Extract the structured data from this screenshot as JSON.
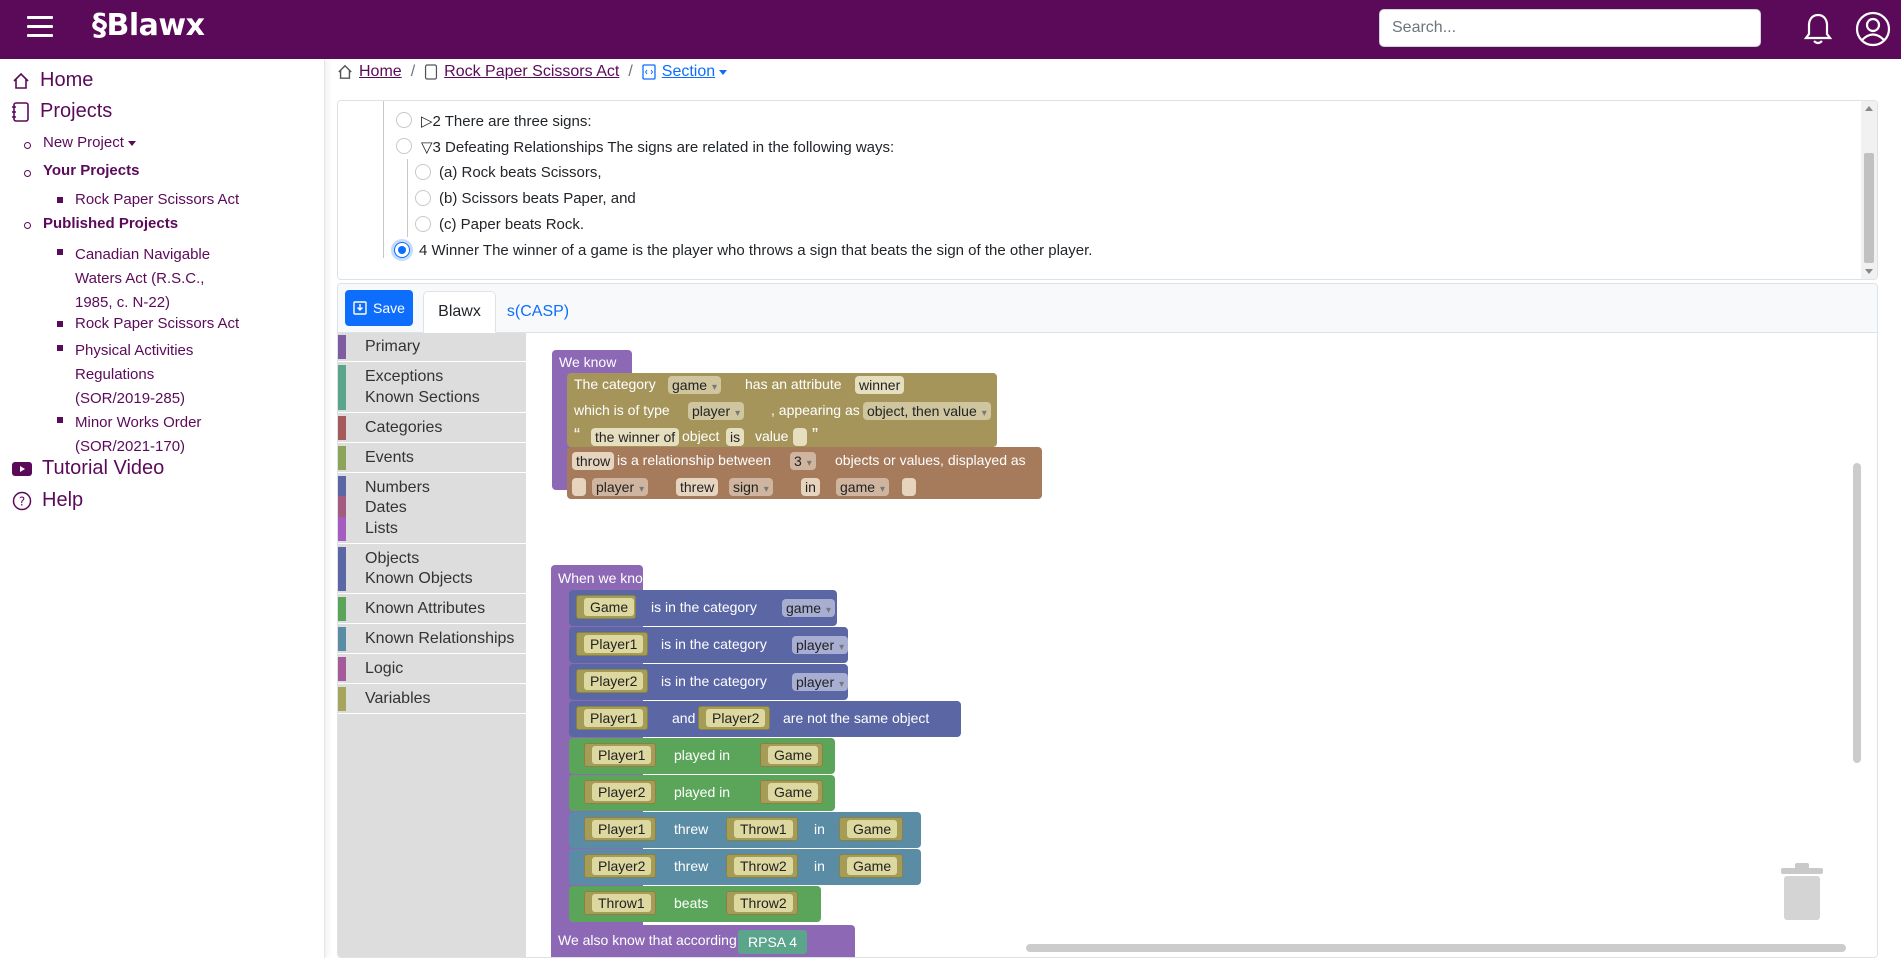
{
  "app": {
    "brand": "§Blawx",
    "search_placeholder": "Search..."
  },
  "sidebar": {
    "home": "Home",
    "projects": "Projects",
    "new_project": "New Project",
    "your_projects": "Your Projects",
    "your_items": [
      "Rock Paper Scissors Act"
    ],
    "published_projects": "Published Projects",
    "published_items": [
      [
        "Canadian Navigable",
        "Waters Act (R.S.C.,",
        "1985, c. N-22)"
      ],
      [
        "Rock Paper Scissors Act"
      ],
      [
        "Physical Activities",
        "Regulations",
        "(SOR/2019-285)"
      ],
      [
        "Minor Works Order",
        "(SOR/2021-170)"
      ]
    ],
    "tutorial": "Tutorial Video",
    "help": "Help"
  },
  "breadcrumb": {
    "home": "Home",
    "project": "Rock Paper Scissors Act",
    "section": "Section"
  },
  "outline": {
    "items": [
      {
        "text": "▷2 There are three signs:"
      },
      {
        "text": "▽3 Defeating Relationships The signs are related in the following ways:"
      },
      {
        "text": "(a) Rock beats Scissors,"
      },
      {
        "text": "(b) Scissors beats Paper, and"
      },
      {
        "text": "(c) Paper beats Rock."
      },
      {
        "text": "4 Winner The winner of a game is the player who throws a sign that beats the sign of the other player."
      }
    ]
  },
  "editor": {
    "save_label": "Save",
    "tabs": [
      "Blawx",
      "s(CASP)"
    ],
    "categories": [
      {
        "label": "Primary",
        "color": "#7e5ca1"
      },
      {
        "label": "Exceptions",
        "color": "#5ba58c"
      },
      {
        "label": "Known Sections",
        "color": "#5ba58c"
      },
      {
        "label": "Categories",
        "color": "#a55b5b"
      },
      {
        "label": "Events",
        "color": "#8ca55b"
      },
      {
        "label": "Numbers",
        "color": "#5b67a5"
      },
      {
        "label": "Dates",
        "color": "#a55b80"
      },
      {
        "label": "Lists",
        "color": "#a55bc0"
      },
      {
        "label": "Objects",
        "color": "#5b67a5"
      },
      {
        "label": "Known Objects",
        "color": "#5b67a5"
      },
      {
        "label": "Known Attributes",
        "color": "#5ba55b"
      },
      {
        "label": "Known Relationships",
        "color": "#5b8ca5"
      },
      {
        "label": "Logic",
        "color": "#a55b99"
      },
      {
        "label": "Variables",
        "color": "#a5a55b"
      }
    ]
  },
  "blocks": {
    "we_know": "We know",
    "attr": {
      "the_category": "The category",
      "game": "game",
      "has_attr": "has an attribute",
      "winner": "winner",
      "which_type": "which is of type",
      "player": "player",
      "appearing": ", appearing as",
      "obj_val": "object, then value",
      "open_q": "“",
      "the_winner_of": "the winner of",
      "object": "object",
      "is": "is",
      "value": "value",
      "close_q": "”"
    },
    "rel": {
      "throw": "throw",
      "is_rel": "is a relationship between",
      "three": "3",
      "objs": "objects or values, displayed as",
      "player": "player",
      "threw": "threw",
      "sign": "sign",
      "in": "in",
      "game": "game"
    },
    "when_we_know": "When we know:",
    "conditions": [
      {
        "a": "Game",
        "mid": "is in the category",
        "dd": "game"
      },
      {
        "a": "Player1",
        "mid": "is in the category",
        "dd": "player"
      },
      {
        "a": "Player2",
        "mid": "is in the category",
        "dd": "player"
      }
    ],
    "not_same": {
      "a": "Player1",
      "and": "and",
      "b": "Player2",
      "rest": "are not the same object"
    },
    "played": [
      {
        "a": "Player1",
        "mid": "played in",
        "b": "Game"
      },
      {
        "a": "Player2",
        "mid": "played in",
        "b": "Game"
      }
    ],
    "threw": [
      {
        "a": "Player1",
        "mid": "threw",
        "b": "Throw1",
        "in": "in",
        "c": "Game"
      },
      {
        "a": "Player2",
        "mid": "threw",
        "b": "Throw2",
        "in": "in",
        "c": "Game"
      }
    ],
    "beats": {
      "a": "Throw1",
      "mid": "beats",
      "b": "Throw2"
    },
    "also_know": "We also know that according to",
    "rpsa": "RPSA 4"
  },
  "colors": {
    "brand": "#5b0a5a",
    "link": "#0d6efd"
  }
}
